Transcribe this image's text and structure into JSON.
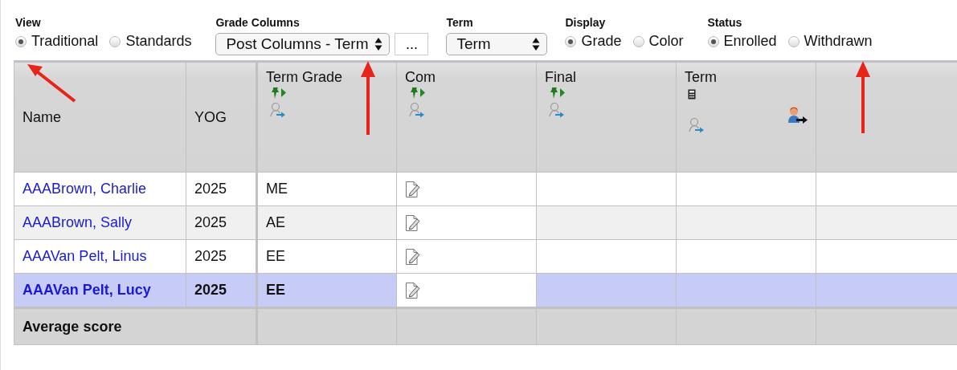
{
  "toolbar": [
    {
      "kind": "radio",
      "label": "View",
      "options": [
        {
          "label": "Traditional",
          "selected": true
        },
        {
          "label": "Standards",
          "selected": false
        }
      ]
    },
    {
      "kind": "select",
      "label": "Grade Columns",
      "value": "Post Columns - Term",
      "button": "..."
    },
    {
      "kind": "select",
      "label": "Term",
      "value": "Term"
    },
    {
      "kind": "radio",
      "label": "Display",
      "options": [
        {
          "label": "Grade",
          "selected": true
        },
        {
          "label": "Color",
          "selected": false
        }
      ]
    },
    {
      "kind": "radio",
      "label": "Status",
      "options": [
        {
          "label": "Enrolled",
          "selected": true
        },
        {
          "label": "Withdrawn",
          "selected": false
        }
      ]
    }
  ],
  "table": {
    "columns": [
      {
        "label": "Name",
        "kind": "plain"
      },
      {
        "label": "YOG",
        "kind": "plain"
      },
      {
        "label": "Term Grade",
        "kind": "post"
      },
      {
        "label": "Com",
        "kind": "post"
      },
      {
        "label": "Final",
        "kind": "post"
      },
      {
        "label": "Term",
        "kind": "calculated"
      }
    ],
    "rows": [
      {
        "name": "AAABrown, Charlie",
        "yog": "2025",
        "term_grade": "ME",
        "selected": false
      },
      {
        "name": "AAABrown, Sally",
        "yog": "2025",
        "term_grade": "AE",
        "selected": false
      },
      {
        "name": "AAAVan Pelt, Linus",
        "yog": "2025",
        "term_grade": "EE",
        "selected": false
      },
      {
        "name": "AAAVan Pelt, Lucy",
        "yog": "2025",
        "term_grade": "EE",
        "selected": true
      }
    ],
    "footer": {
      "label": "Average score"
    }
  }
}
